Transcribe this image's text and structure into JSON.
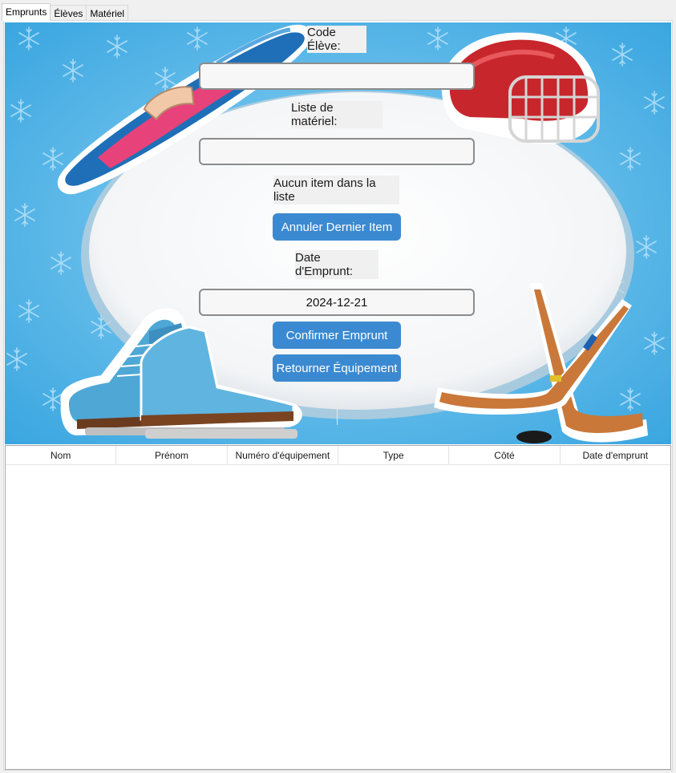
{
  "tabs": [
    {
      "label": "Emprunts",
      "active": true
    },
    {
      "label": "Élèves",
      "active": false
    },
    {
      "label": "Matériel",
      "active": false
    }
  ],
  "form": {
    "code_eleve_label": "Code Élève:",
    "code_eleve_value": "",
    "liste_materiel_label": "Liste de matériel:",
    "liste_materiel_value": "",
    "status_text": "Aucun item dans la liste",
    "annuler_button": "Annuler Dernier Item",
    "date_label": "Date d'Emprunt:",
    "date_value": "2024-12-21",
    "confirmer_button": "Confirmer Emprunt",
    "retourner_button": "Retourner Équipement"
  },
  "table": {
    "columns": [
      "Nom",
      "Prénom",
      "Numéro d'équipement",
      "Type",
      "Côté",
      "Date d'emprunt"
    ],
    "rows": []
  },
  "colors": {
    "accent": "#3b8ad1",
    "sky": "#4fb3e6"
  },
  "illustrations": [
    "snowboard-icon",
    "hockey-helmet-icon",
    "ice-skates-icon",
    "hockey-sticks-icon",
    "snowflake-icon"
  ]
}
